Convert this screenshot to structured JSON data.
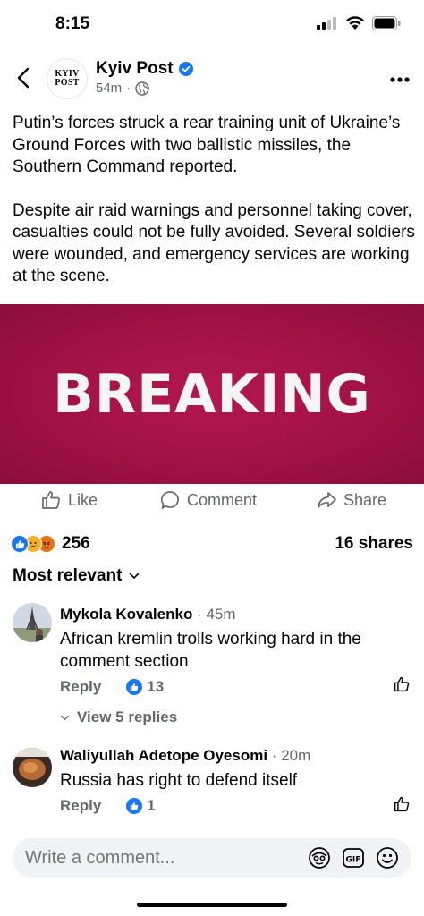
{
  "status_bar": {
    "time": "8:15"
  },
  "header": {
    "avatar_line1": "KYIV",
    "avatar_line2": "POST",
    "page_name": "Kyiv Post",
    "time_ago": "54m",
    "separator": "·"
  },
  "post": {
    "paragraph1": "Putin’s forces struck a rear training unit of Ukraine’s Ground Forces with two ballistic missiles, the Southern Command reported.",
    "paragraph2": "Despite air raid warnings and personnel taking cover, casualties could not be fully avoided. Several soldiers were wounded, and emergency services are working at the scene.",
    "image_text": "BREAKING"
  },
  "actions": {
    "like_label": "Like",
    "comment_label": "Comment",
    "share_label": "Share"
  },
  "engagement": {
    "reaction_count": "256",
    "shares": "16 shares"
  },
  "sort": {
    "label": "Most relevant"
  },
  "comments": [
    {
      "author": "Mykola Kovalenko",
      "time": "45m",
      "text": "African kremlin trolls working hard in the comment section",
      "reply_label": "Reply",
      "likes": "13",
      "view_replies": "View 5 replies"
    },
    {
      "author": "Waliyullah Adetope Oyesomi",
      "time": "20m",
      "text": "Russia has right to defend itself",
      "reply_label": "Reply",
      "likes": "1"
    }
  ],
  "composer": {
    "placeholder": "Write a comment..."
  },
  "colors": {
    "brand_blue": "#1877f2",
    "image_bg": "#a11245",
    "muted_text": "#65676b"
  }
}
